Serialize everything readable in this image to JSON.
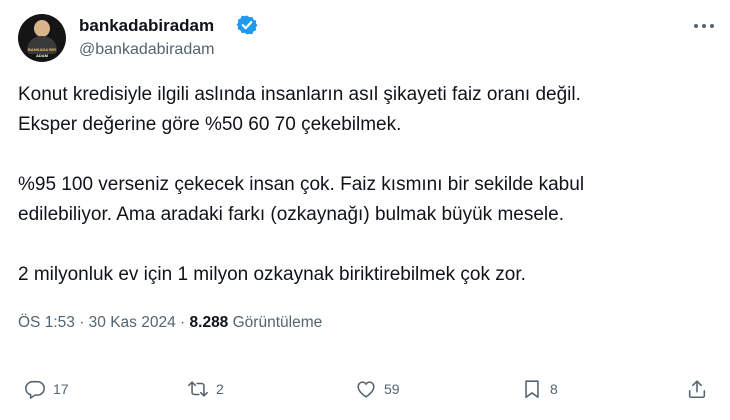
{
  "author": {
    "display_name": "bankadabiradam",
    "handle": "@bankadabiradam",
    "verified": true,
    "avatar_caption_top": "BANKADA BIR",
    "avatar_caption_bottom": "ADAM"
  },
  "tweet": {
    "lines": [
      "Konut kredisiyle ilgili aslında insanların asıl şikayeti faiz oranı değil.",
      "Eksper değerine göre %50 60 70 çekebilmek.",
      "%95 100 verseniz çekecek insan çok. Faiz kısmını bir sekilde kabul",
      "edilebiliyor. Ama aradaki farkı (ozkaynağı) bulmak büyük mesele.",
      "2 milyonluk ev için 1 milyon ozkaynak biriktirebilmek çok zor."
    ]
  },
  "meta": {
    "time": "ÖS 1:53",
    "separator": "·",
    "date": "30 Kas 2024",
    "views_count": "8.288",
    "views_label": "Görüntüleme"
  },
  "actions": {
    "reply_count": "17",
    "retweet_count": "2",
    "like_count": "59",
    "bookmark_count": "8"
  },
  "icons": {
    "verified": "verified-badge-icon",
    "more": "more-options-icon",
    "reply": "reply-icon",
    "retweet": "retweet-icon",
    "like": "heart-icon",
    "bookmark": "bookmark-icon",
    "share": "share-icon"
  },
  "colors": {
    "verified_blue": "#1d9bf0",
    "text_primary": "#0f1419",
    "text_secondary": "#536471"
  }
}
